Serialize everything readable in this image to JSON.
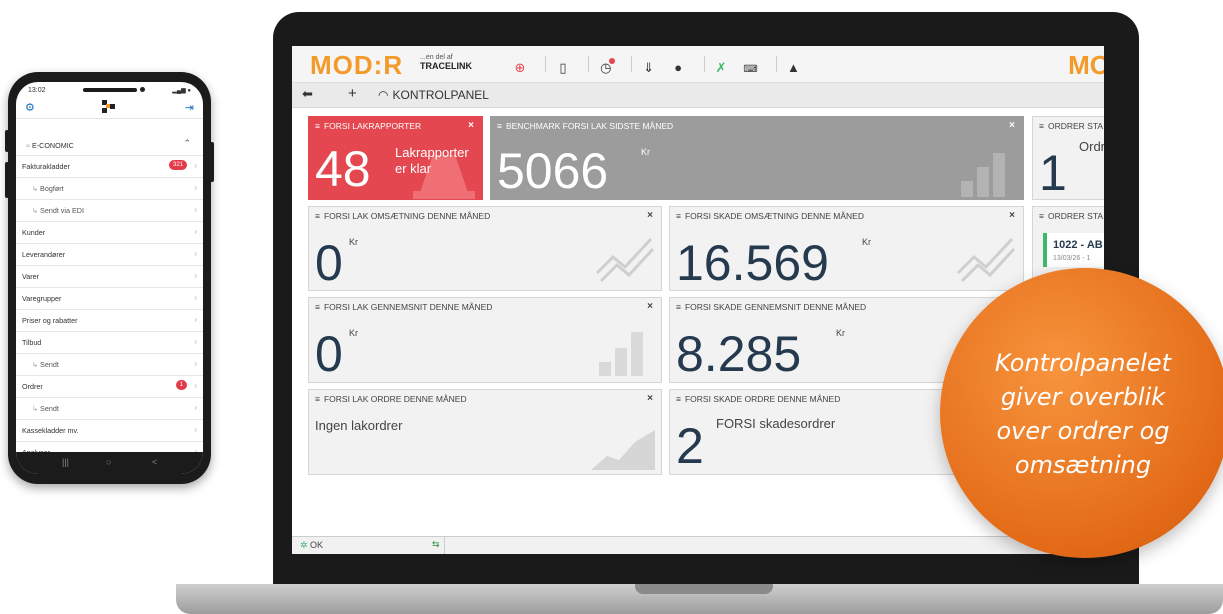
{
  "phone": {
    "status_time": "13:02",
    "section_label": "E-CONOMIC",
    "items": [
      {
        "label": "Fakturakladder",
        "badge": "321",
        "sub": false
      },
      {
        "label": "Bogført",
        "badge": "",
        "sub": true
      },
      {
        "label": "Sendt via EDI",
        "badge": "",
        "sub": true
      },
      {
        "label": "Kunder",
        "badge": "",
        "sub": false
      },
      {
        "label": "Leverandører",
        "badge": "",
        "sub": false
      },
      {
        "label": "Varer",
        "badge": "",
        "sub": false
      },
      {
        "label": "Varegrupper",
        "badge": "",
        "sub": false
      },
      {
        "label": "Priser og rabatter",
        "badge": "",
        "sub": false
      },
      {
        "label": "Tilbud",
        "badge": "",
        "sub": false
      },
      {
        "label": "Sendt",
        "badge": "",
        "sub": true
      },
      {
        "label": "Ordrer",
        "badge": "1",
        "sub": false
      },
      {
        "label": "Sendt",
        "badge": "",
        "sub": true
      },
      {
        "label": "Kassekladder mv.",
        "badge": "",
        "sub": false
      },
      {
        "label": "Analyser",
        "badge": "",
        "sub": false
      }
    ],
    "nav": [
      "|||",
      "○",
      "<"
    ]
  },
  "app": {
    "logo": "MOD:R",
    "logo_sub_small": "...en del af",
    "logo_sub_brand": "TRACELINK",
    "logo_right": "MO",
    "nav_title": "KONTROLPANEL",
    "status_ok": "OK",
    "accent": "#f39a2a"
  },
  "tiles": {
    "lak_rapporter": {
      "title": "FORSI LAKRAPPORTER",
      "value": "48",
      "desc1": "Lakrapporter",
      "desc2": "er klar"
    },
    "benchmark": {
      "title": "BENCHMARK FORSI LAK SIDSTE MÅNED",
      "value": "5066",
      "unit": "Kr"
    },
    "ordrer_st1": {
      "title": "ORDRER STA",
      "value": "1",
      "desc": "Ordre"
    },
    "lak_oms": {
      "title": "FORSI LAK OMSÆTNING DENNE MÅNED",
      "value": "0",
      "unit": "Kr"
    },
    "skade_oms": {
      "title": "FORSI SKADE OMSÆTNING DENNE MÅNED",
      "value": "16.569",
      "unit": "Kr"
    },
    "ordrer_st2": {
      "title": "ORDRER STA",
      "order_no": "1022 - AB",
      "order_date": "13/03/26 - 1"
    },
    "lak_gns": {
      "title": "FORSI LAK GENNEMSNIT DENNE MÅNED",
      "value": "0",
      "unit": "Kr"
    },
    "skade_gns": {
      "title": "FORSI SKADE GENNEMSNIT DENNE MÅNED",
      "value": "8.285",
      "unit": "Kr"
    },
    "lak_ordre": {
      "title": "FORSI LAK ORDRE DENNE MÅNED",
      "desc": "Ingen lakordrer"
    },
    "skade_ordre": {
      "title": "FORSI SKADE ORDRE DENNE MÅNED",
      "value": "2",
      "desc": "FORSI skadesordrer"
    }
  },
  "promo": {
    "lines": [
      "Kontrolpanelet",
      "giver overblik",
      "over ordrer og",
      "omsætning"
    ]
  }
}
